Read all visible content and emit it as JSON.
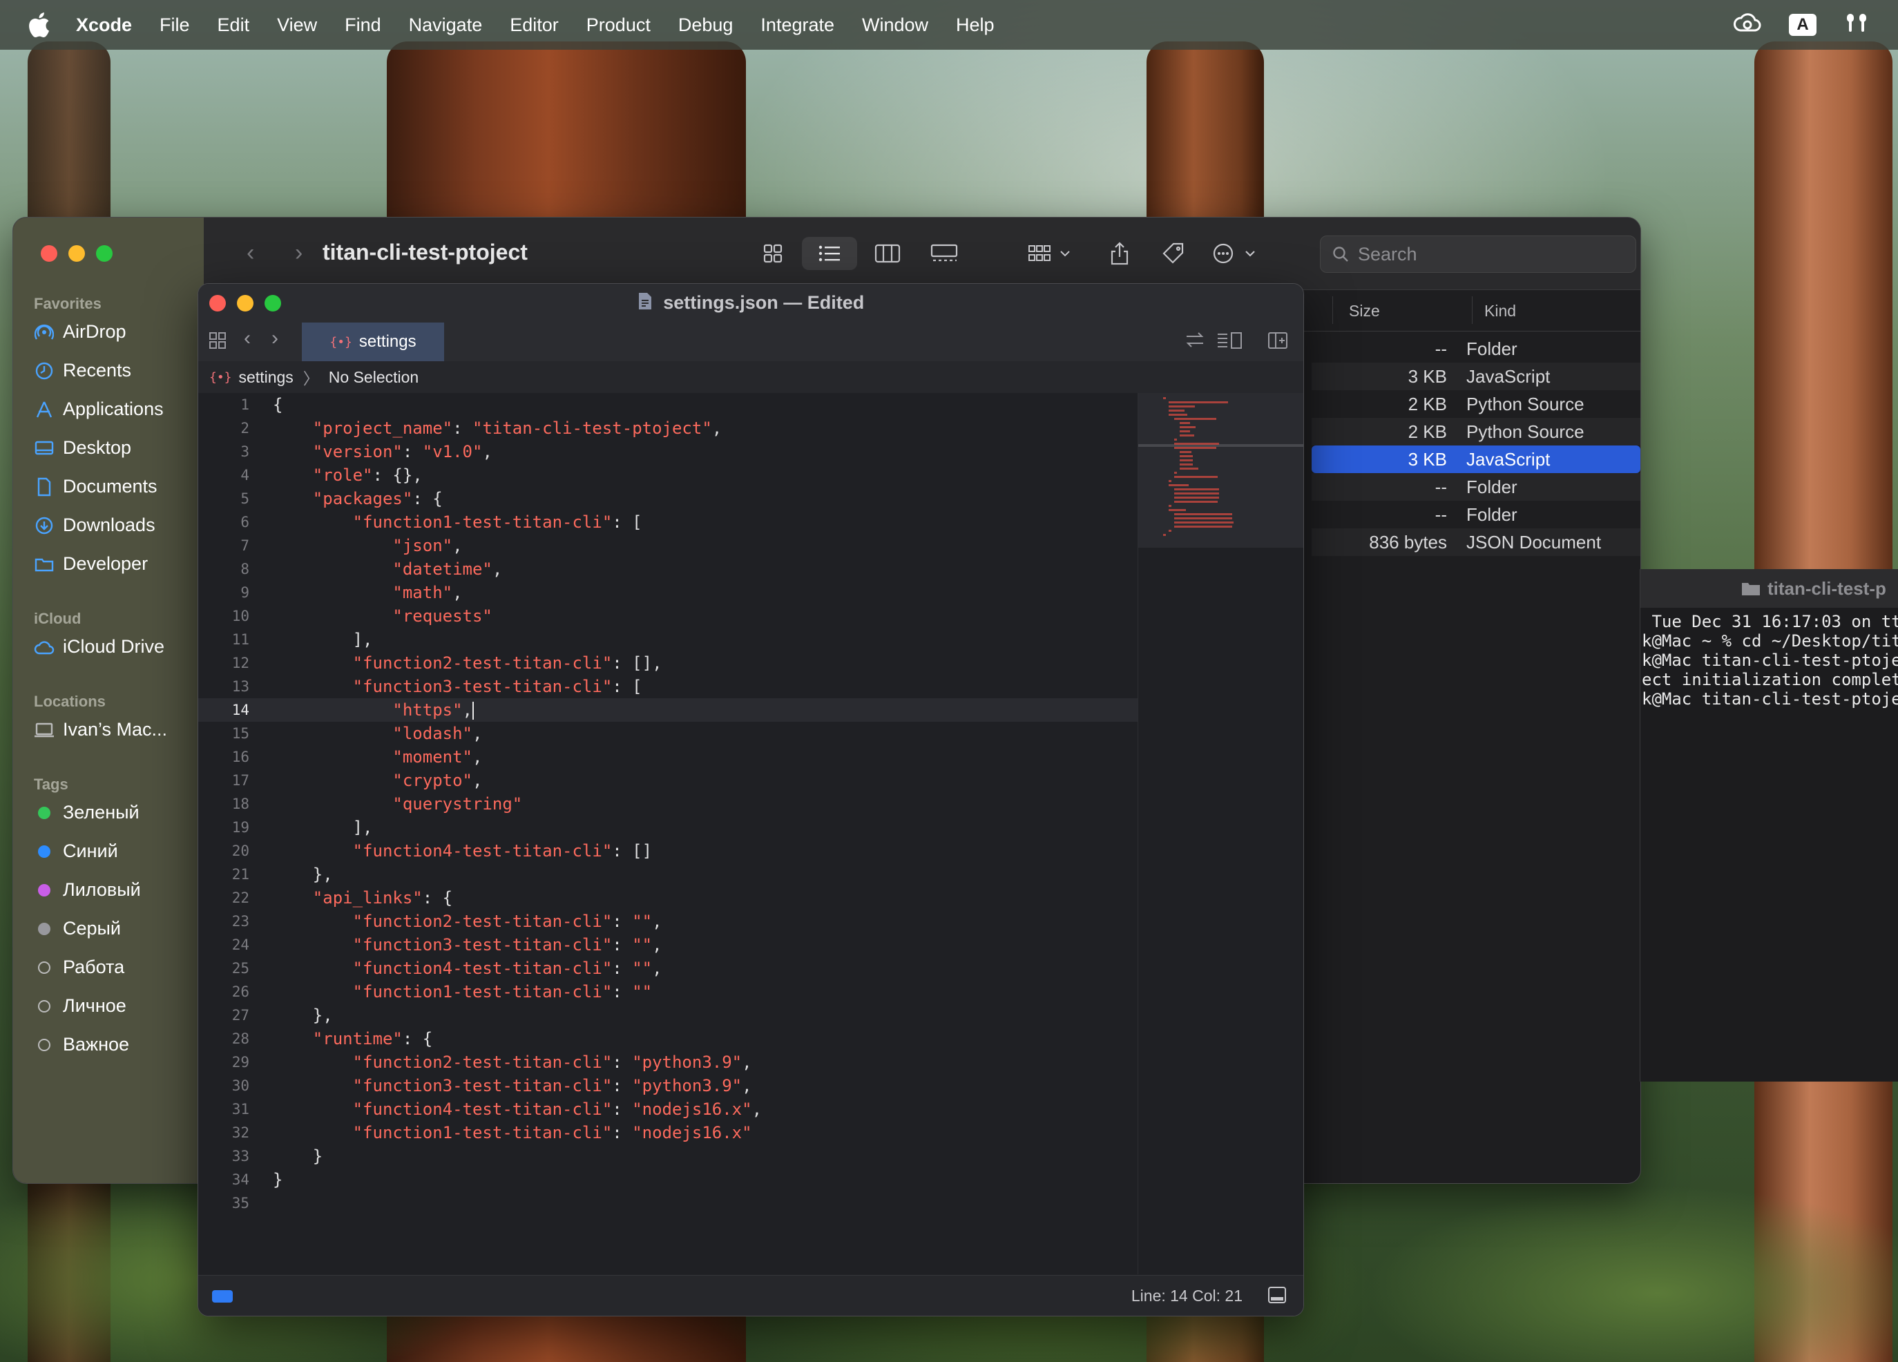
{
  "menubar": {
    "app": "Xcode",
    "items": [
      "File",
      "Edit",
      "View",
      "Find",
      "Navigate",
      "Editor",
      "Product",
      "Debug",
      "Integrate",
      "Window",
      "Help"
    ],
    "input_badge": "A"
  },
  "finder": {
    "title": "titan-cli-test-ptoject",
    "search_placeholder": "Search",
    "sidebar": {
      "favorites_label": "Favorites",
      "favorites": [
        "AirDrop",
        "Recents",
        "Applications",
        "Desktop",
        "Documents",
        "Downloads",
        "Developer"
      ],
      "icloud_label": "iCloud",
      "icloud": [
        "iCloud Drive"
      ],
      "locations_label": "Locations",
      "locations": [
        "Ivan’s Mac..."
      ],
      "tags_label": "Tags",
      "tags": [
        {
          "name": "Зеленый",
          "color": "#34c759"
        },
        {
          "name": "Синий",
          "color": "#2d8cff"
        },
        {
          "name": "Лиловый",
          "color": "#c95ee8"
        },
        {
          "name": "Серый",
          "color": "#98989d"
        },
        {
          "name": "Работа",
          "color": ""
        },
        {
          "name": "Личное",
          "color": ""
        },
        {
          "name": "Важное",
          "color": ""
        }
      ]
    },
    "columns": {
      "size": "Size",
      "kind": "Kind"
    },
    "rows": [
      {
        "size": "--",
        "kind": "Folder"
      },
      {
        "size": "3 KB",
        "kind": "JavaScript"
      },
      {
        "size": "2 KB",
        "kind": "Python Source"
      },
      {
        "size": "2 KB",
        "kind": "Python Source"
      },
      {
        "size": "3 KB",
        "kind": "JavaScript",
        "selected": true
      },
      {
        "size": "--",
        "kind": "Folder"
      },
      {
        "size": "--",
        "kind": "Folder"
      },
      {
        "size": "836 bytes",
        "kind": "JSON Document"
      }
    ]
  },
  "terminal": {
    "title": "titan-cli-test-p",
    "lines": [
      " Tue Dec 31 16:17:03 on tt",
      "k@Mac ~ % cd ~/Desktop/tit",
      "k@Mac titan-cli-test-ptoje",
      "ect initialization complet",
      "k@Mac titan-cli-test-ptoje"
    ]
  },
  "editor": {
    "window_title": "settings.json — Edited",
    "tab_label": "settings",
    "jump_file": "settings",
    "jump_selection": "No Selection",
    "current_line": 14,
    "status": "Line: 14  Col: 21",
    "code": [
      "{",
      "    \"project_name\": \"titan-cli-test-ptoject\",",
      "    \"version\": \"v1.0\",",
      "    \"role\": {},",
      "    \"packages\": {",
      "        \"function1-test-titan-cli\": [",
      "            \"json\",",
      "            \"datetime\",",
      "            \"math\",",
      "            \"requests\"",
      "        ],",
      "        \"function2-test-titan-cli\": [],",
      "        \"function3-test-titan-cli\": [",
      "            \"https\",",
      "            \"lodash\",",
      "            \"moment\",",
      "            \"crypto\",",
      "            \"querystring\"",
      "        ],",
      "        \"function4-test-titan-cli\": []",
      "    },",
      "    \"api_links\": {",
      "        \"function2-test-titan-cli\": \"\",",
      "        \"function3-test-titan-cli\": \"\",",
      "        \"function4-test-titan-cli\": \"\",",
      "        \"function1-test-titan-cli\": \"\"",
      "    },",
      "    \"runtime\": {",
      "        \"function2-test-titan-cli\": \"python3.9\",",
      "        \"function3-test-titan-cli\": \"python3.9\",",
      "        \"function4-test-titan-cli\": \"nodejs16.x\",",
      "        \"function1-test-titan-cli\": \"nodejs16.x\"",
      "    }",
      "}",
      ""
    ]
  }
}
